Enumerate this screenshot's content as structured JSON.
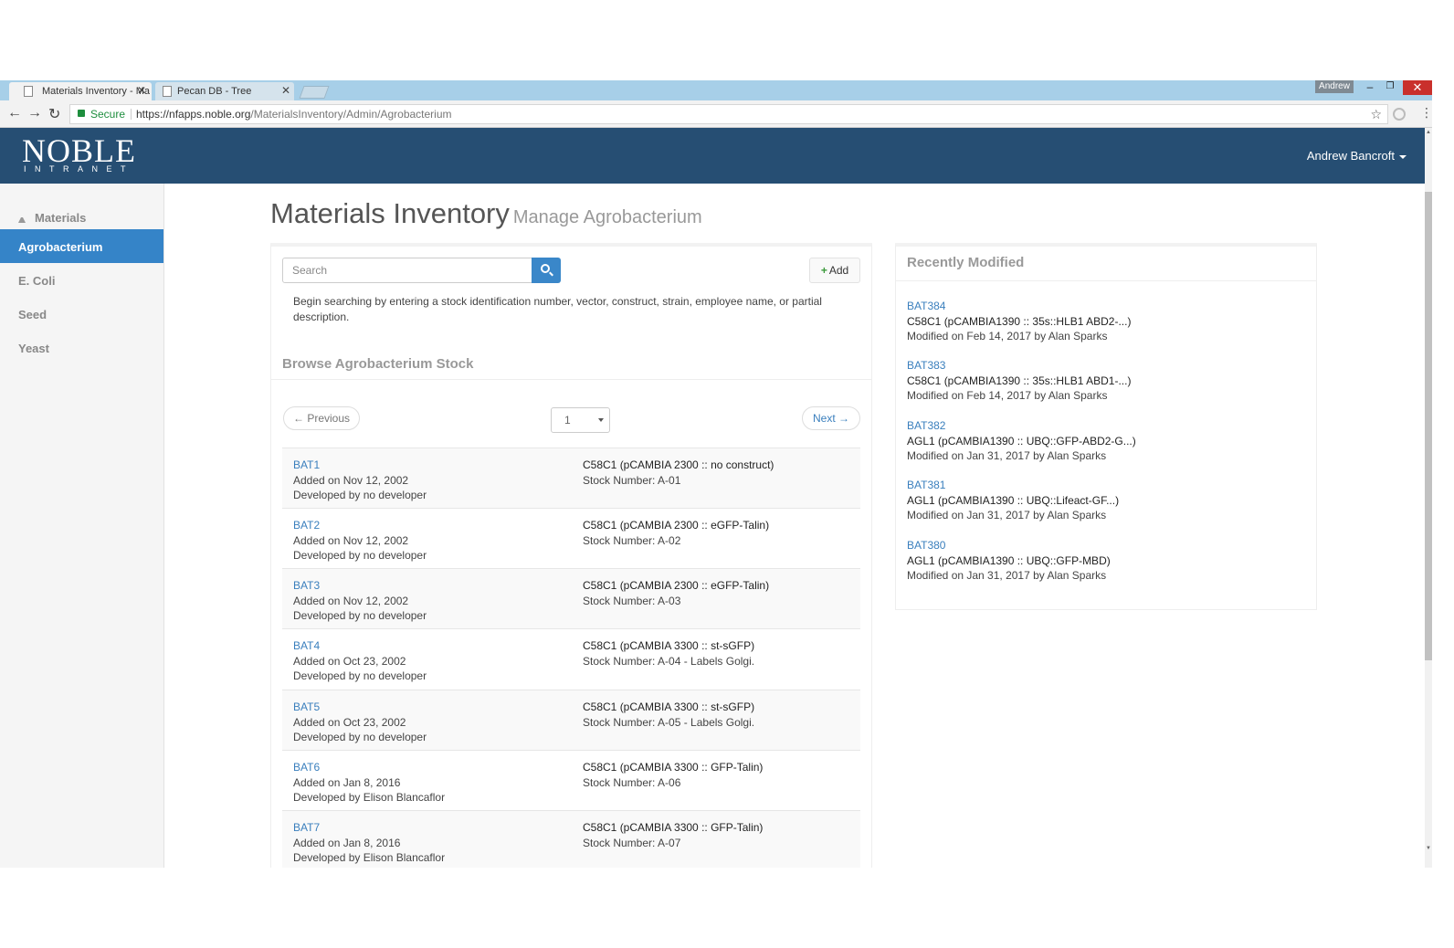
{
  "browser": {
    "tabs": [
      {
        "title": "Materials Inventory - Ma",
        "active": true
      },
      {
        "title": "Pecan DB - Tree",
        "active": false
      }
    ],
    "user_badge": "Andrew",
    "secure_label": "Secure",
    "url_host": "https://nfapps.noble.org",
    "url_path": "/MaterialsInventory/Admin/Agrobacterium"
  },
  "header": {
    "logo": "NOBLE",
    "logo_sub": "INTRANET",
    "user": "Andrew Bancroft"
  },
  "sidebar": {
    "items": [
      {
        "label": "Materials",
        "active": false
      },
      {
        "label": "Agrobacterium",
        "active": true
      },
      {
        "label": "E. Coli",
        "active": false
      },
      {
        "label": "Seed",
        "active": false
      },
      {
        "label": "Yeast",
        "active": false
      }
    ]
  },
  "page": {
    "title": "Materials Inventory",
    "subtitle": "Manage Agrobacterium"
  },
  "search": {
    "placeholder": "Search",
    "add_label": "Add",
    "help": "Begin searching by entering a stock identification number, vector, construct, strain, employee name, or partial description."
  },
  "browse": {
    "title": "Browse Agrobacterium Stock",
    "previous": "← Previous",
    "next": "Next →",
    "page": "1",
    "rows": [
      {
        "id": "BAT1",
        "added": "Added on Nov 12, 2002",
        "developer": "Developed by no developer",
        "construct": "C58C1 (pCAMBIA 2300 :: no construct)",
        "stock": "Stock Number: A-01"
      },
      {
        "id": "BAT2",
        "added": "Added on Nov 12, 2002",
        "developer": "Developed by no developer",
        "construct": "C58C1 (pCAMBIA 2300 :: eGFP-Talin)",
        "stock": "Stock Number: A-02"
      },
      {
        "id": "BAT3",
        "added": "Added on Nov 12, 2002",
        "developer": "Developed by no developer",
        "construct": "C58C1 (pCAMBIA 2300 :: eGFP-Talin)",
        "stock": "Stock Number: A-03"
      },
      {
        "id": "BAT4",
        "added": "Added on Oct 23, 2002",
        "developer": "Developed by no developer",
        "construct": "C58C1 (pCAMBIA 3300 :: st-sGFP)",
        "stock": "Stock Number: A-04 - Labels Golgi."
      },
      {
        "id": "BAT5",
        "added": "Added on Oct 23, 2002",
        "developer": "Developed by no developer",
        "construct": "C58C1 (pCAMBIA 3300 :: st-sGFP)",
        "stock": "Stock Number: A-05 - Labels Golgi."
      },
      {
        "id": "BAT6",
        "added": "Added on Jan 8, 2016",
        "developer": "Developed by Elison Blancaflor",
        "construct": "C58C1 (pCAMBIA 3300 :: GFP-Talin)",
        "stock": "Stock Number: A-06"
      },
      {
        "id": "BAT7",
        "added": "Added on Jan 8, 2016",
        "developer": "Developed by Elison Blancaflor",
        "construct": "C58C1 (pCAMBIA 3300 :: GFP-Talin)",
        "stock": "Stock Number: A-07"
      }
    ]
  },
  "recent": {
    "title": "Recently Modified",
    "items": [
      {
        "id": "BAT384",
        "desc": "C58C1 (pCAMBIA1390 :: 35s::HLB1 ABD2-...)",
        "modified": "Modified on Feb 14, 2017 by Alan Sparks"
      },
      {
        "id": "BAT383",
        "desc": "C58C1 (pCAMBIA1390 :: 35s::HLB1 ABD1-...)",
        "modified": "Modified on Feb 14, 2017 by Alan Sparks"
      },
      {
        "id": "BAT382",
        "desc": "AGL1 (pCAMBIA1390 :: UBQ::GFP-ABD2-G...)",
        "modified": "Modified on Jan 31, 2017 by Alan Sparks"
      },
      {
        "id": "BAT381",
        "desc": "AGL1 (pCAMBIA1390 :: UBQ::Lifeact-GF...)",
        "modified": "Modified on Jan 31, 2017 by Alan Sparks"
      },
      {
        "id": "BAT380",
        "desc": "AGL1 (pCAMBIA1390 :: UBQ::GFP-MBD)",
        "modified": "Modified on Jan 31, 2017 by Alan Sparks"
      }
    ]
  },
  "colors": {
    "header": "#264e73",
    "accent": "#3584c8",
    "link": "#3a7fbd"
  }
}
